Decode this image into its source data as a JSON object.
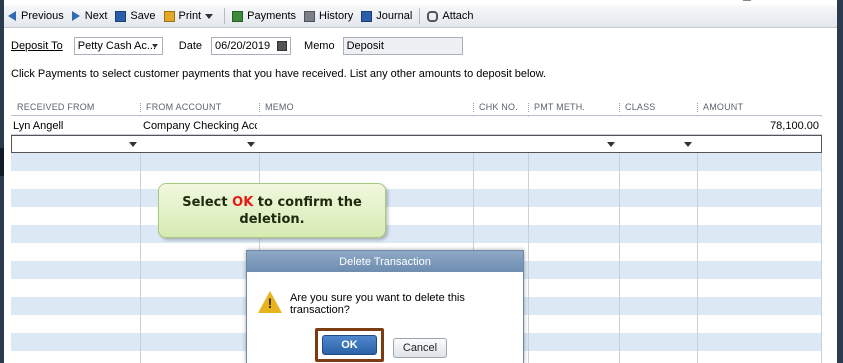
{
  "toolbar": {
    "previous": "Previous",
    "next": "Next",
    "save": "Save",
    "print": "Print",
    "payments": "Payments",
    "history": "History",
    "journal": "Journal",
    "attach": "Attach"
  },
  "header": {
    "deposit_to_label": "Deposit To",
    "deposit_to_value": "Petty Cash Ac...",
    "date_label": "Date",
    "date_value": "06/20/2019",
    "memo_label": "Memo",
    "memo_value": "Deposit"
  },
  "instructions": "Click Payments to select customer payments that you have received. List any other amounts to deposit below.",
  "grid": {
    "columns": [
      "RECEIVED FROM",
      "FROM ACCOUNT",
      "MEMO",
      "CHK NO.",
      "PMT METH.",
      "CLASS",
      "AMOUNT"
    ],
    "rows": [
      {
        "received_from": "Lyn Angell",
        "from_account": "Company Checking Acc...",
        "memo": "",
        "chk_no": "",
        "pmt_meth": "",
        "class": "",
        "amount": "78,100.00"
      }
    ]
  },
  "callout": {
    "prefix": "Select ",
    "highlight": "OK",
    "suffix": " to confirm the deletion."
  },
  "dialog": {
    "title": "Delete Transaction",
    "message": "Are you sure you want to delete this transaction?",
    "ok_label": "OK",
    "cancel_label": "Cancel"
  },
  "colors": {
    "highlight_red": "#e41b17",
    "ok_frame": "#7a3c10",
    "row_alt": "#dde8f5"
  }
}
